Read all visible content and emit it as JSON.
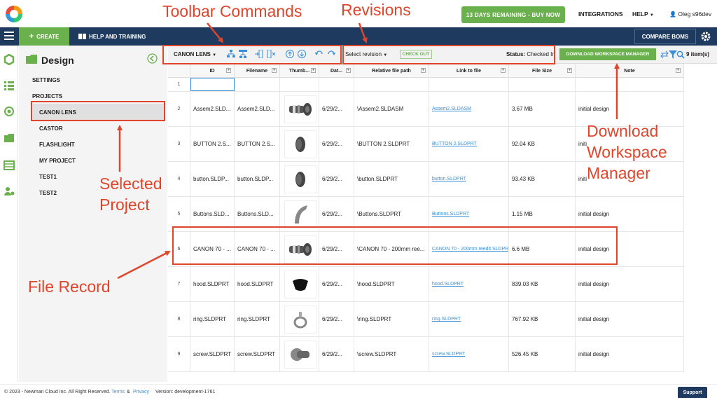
{
  "topbar": {
    "trial_button": "13 DAYS REMAINING - BUY NOW",
    "integrations": "INTEGRATIONS",
    "help": "HELP",
    "user": "Oleg s96dev"
  },
  "navbar": {
    "create": "CREATE",
    "help_training": "HELP AND TRAINING",
    "compare_boms": "COMPARE BOMS"
  },
  "panel": {
    "title": "Design",
    "settings": "SETTINGS",
    "projects": "PROJECTS",
    "items": [
      "CANON LENS",
      "CASTOR",
      "FLASHLIGHT",
      "MY PROJECT",
      "TEST1",
      "TEST2"
    ]
  },
  "toolbar": {
    "project_dropdown": "CANON LENS",
    "select_revision": "Select revision",
    "check_out": "CHECK OUT",
    "status_label": "Status:",
    "status_value": "Checked In",
    "download_wm": "DOWNLOAD WORKSPACE MANAGER",
    "items_count": "9 item(s)"
  },
  "table": {
    "headers": [
      "",
      "ID",
      "Filename",
      "Thumb...",
      "Dat...",
      "Relative file path",
      "Link to file",
      "File Size",
      "Note"
    ],
    "rows": [
      {
        "n": "1",
        "id": "",
        "filename": "",
        "date": "",
        "path": "",
        "link": "",
        "size": "",
        "note": "",
        "thumb": ""
      },
      {
        "n": "2",
        "id": "Assem2.SLD...",
        "filename": "Assem2.SLD...",
        "date": "6/29/2...",
        "path": "\\Assem2.SLDASM",
        "link": "Assem2.SLDASM",
        "size": "3.67 MB",
        "note": "initial design",
        "thumb": "lens"
      },
      {
        "n": "3",
        "id": "BUTTON 2.S...",
        "filename": "BUTTON 2.S...",
        "date": "6/29/2...",
        "path": "\\BUTTON 2.SLDPRT",
        "link": "BUTTON 2.SLDPRT",
        "size": "92.04 KB",
        "note": "initi",
        "thumb": "button"
      },
      {
        "n": "4",
        "id": "button.SLDP...",
        "filename": "button.SLDP...",
        "date": "6/29/2...",
        "path": "\\button.SLDPRT",
        "link": "button.SLDPRT",
        "size": "93.43 KB",
        "note": "initi",
        "thumb": "button"
      },
      {
        "n": "5",
        "id": "Buttons.SLD...",
        "filename": "Buttons.SLD...",
        "date": "6/29/2...",
        "path": "\\Buttons.SLDPRT",
        "link": "Buttons.SLDPRT",
        "size": "1.15 MB",
        "note": "initial design",
        "thumb": "arc"
      },
      {
        "n": "6",
        "id": "CANON 70 - ...",
        "filename": "CANON 70 - ...",
        "date": "6/29/2...",
        "path": "\\CANON 70 - 200mm ree...",
        "link": "CANON 70 - 200mm reedit.SLDPRT",
        "size": "6.6 MB",
        "note": "initial design",
        "thumb": "lens"
      },
      {
        "n": "7",
        "id": "hood.SLDPRT",
        "filename": "hood.SLDPRT",
        "date": "6/29/2...",
        "path": "\\hood.SLDPRT",
        "link": "hood.SLDPRT",
        "size": "839.03 KB",
        "note": "initial design",
        "thumb": "hood"
      },
      {
        "n": "8",
        "id": "ring.SLDPRT",
        "filename": "ring.SLDPRT",
        "date": "6/29/2...",
        "path": "\\ring.SLDPRT",
        "link": "ring.SLDPRT",
        "size": "767.92 KB",
        "note": "initial design",
        "thumb": "ring"
      },
      {
        "n": "9",
        "id": "screw.SLDPRT",
        "filename": "screw.SLDPRT",
        "date": "6/29/2...",
        "path": "\\screw.SLDPRT",
        "link": "screw.SLDPRT",
        "size": "526.45 KB",
        "note": "initial design",
        "thumb": "screw"
      }
    ]
  },
  "footer": {
    "copyright": "© 2023 - Newman Cloud Inc. All Right Reserved.",
    "terms": "Terms",
    "amp": "&",
    "privacy": "Privacy",
    "version": "Version: development-1761",
    "support": "Support"
  },
  "annotations": {
    "toolbar_commands": "Toolbar Commands",
    "revisions": "Revisions",
    "download_line1": "Download",
    "download_line2": "Workspace",
    "download_line3": "Manager",
    "selected_line1": "Selected",
    "selected_line2": "Project",
    "file_record": "File Record",
    "color": "#e0452b"
  },
  "colors": {
    "accent_green": "#6ab04c",
    "nav_blue": "#1f3a5f",
    "link_blue": "#3a8fd9"
  }
}
